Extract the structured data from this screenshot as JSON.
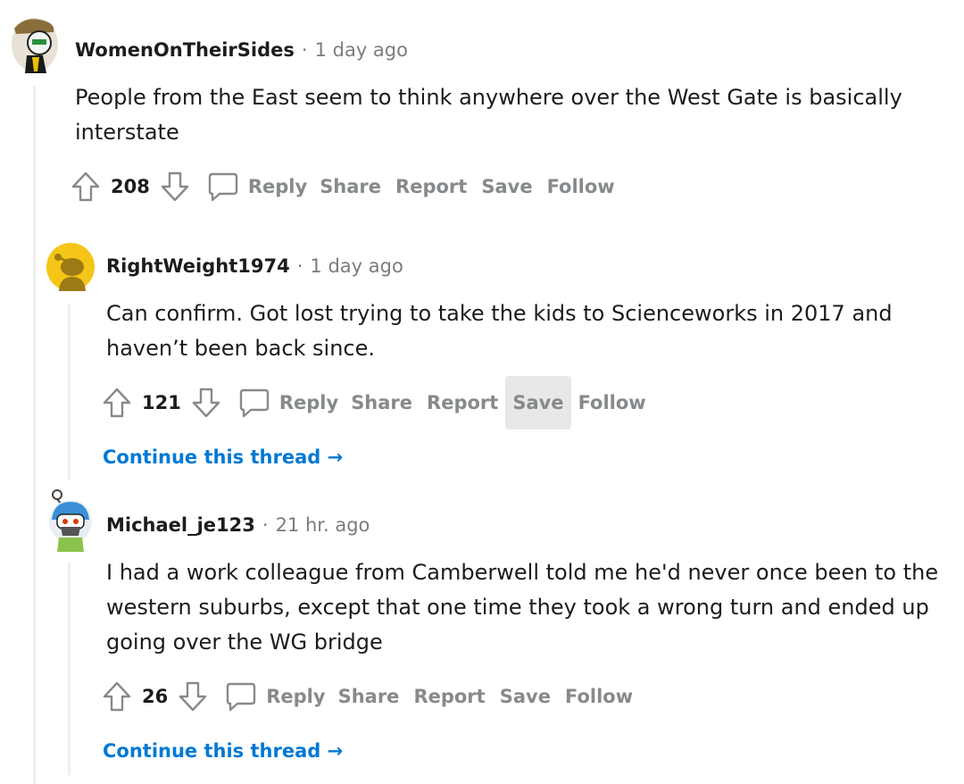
{
  "comments": [
    {
      "author": "WomenOnTheirSides",
      "time": "1 day ago",
      "body_lines": [
        "People from the East seem to think anywhere over the West Gate is basically",
        "interstate"
      ],
      "score": "208"
    },
    {
      "author": "RightWeight1974",
      "time": "1 day ago",
      "body_lines": [
        "Can confirm. Got lost trying to take the kids to Scienceworks in 2017 and",
        "haven’t been back since."
      ],
      "score": "121",
      "continue": "Continue this thread →"
    },
    {
      "author": "Michael_je123",
      "time": "21 hr. ago",
      "body_lines": [
        "I had a work colleague from Camberwell told me he'd never once been to the",
        "western suburbs, except that one time they took a wrong turn and ended up",
        "going over the WG bridge"
      ],
      "score": "26",
      "continue": "Continue this thread →"
    }
  ],
  "actions": {
    "reply": "Reply",
    "share": "Share",
    "report": "Report",
    "save": "Save",
    "follow": "Follow"
  },
  "meta_separator": "·",
  "colors": {
    "link": "#0079d3",
    "muted": "#878a8c",
    "thread_line": "#edeff1",
    "hover_bg": "#e8e8e8"
  }
}
